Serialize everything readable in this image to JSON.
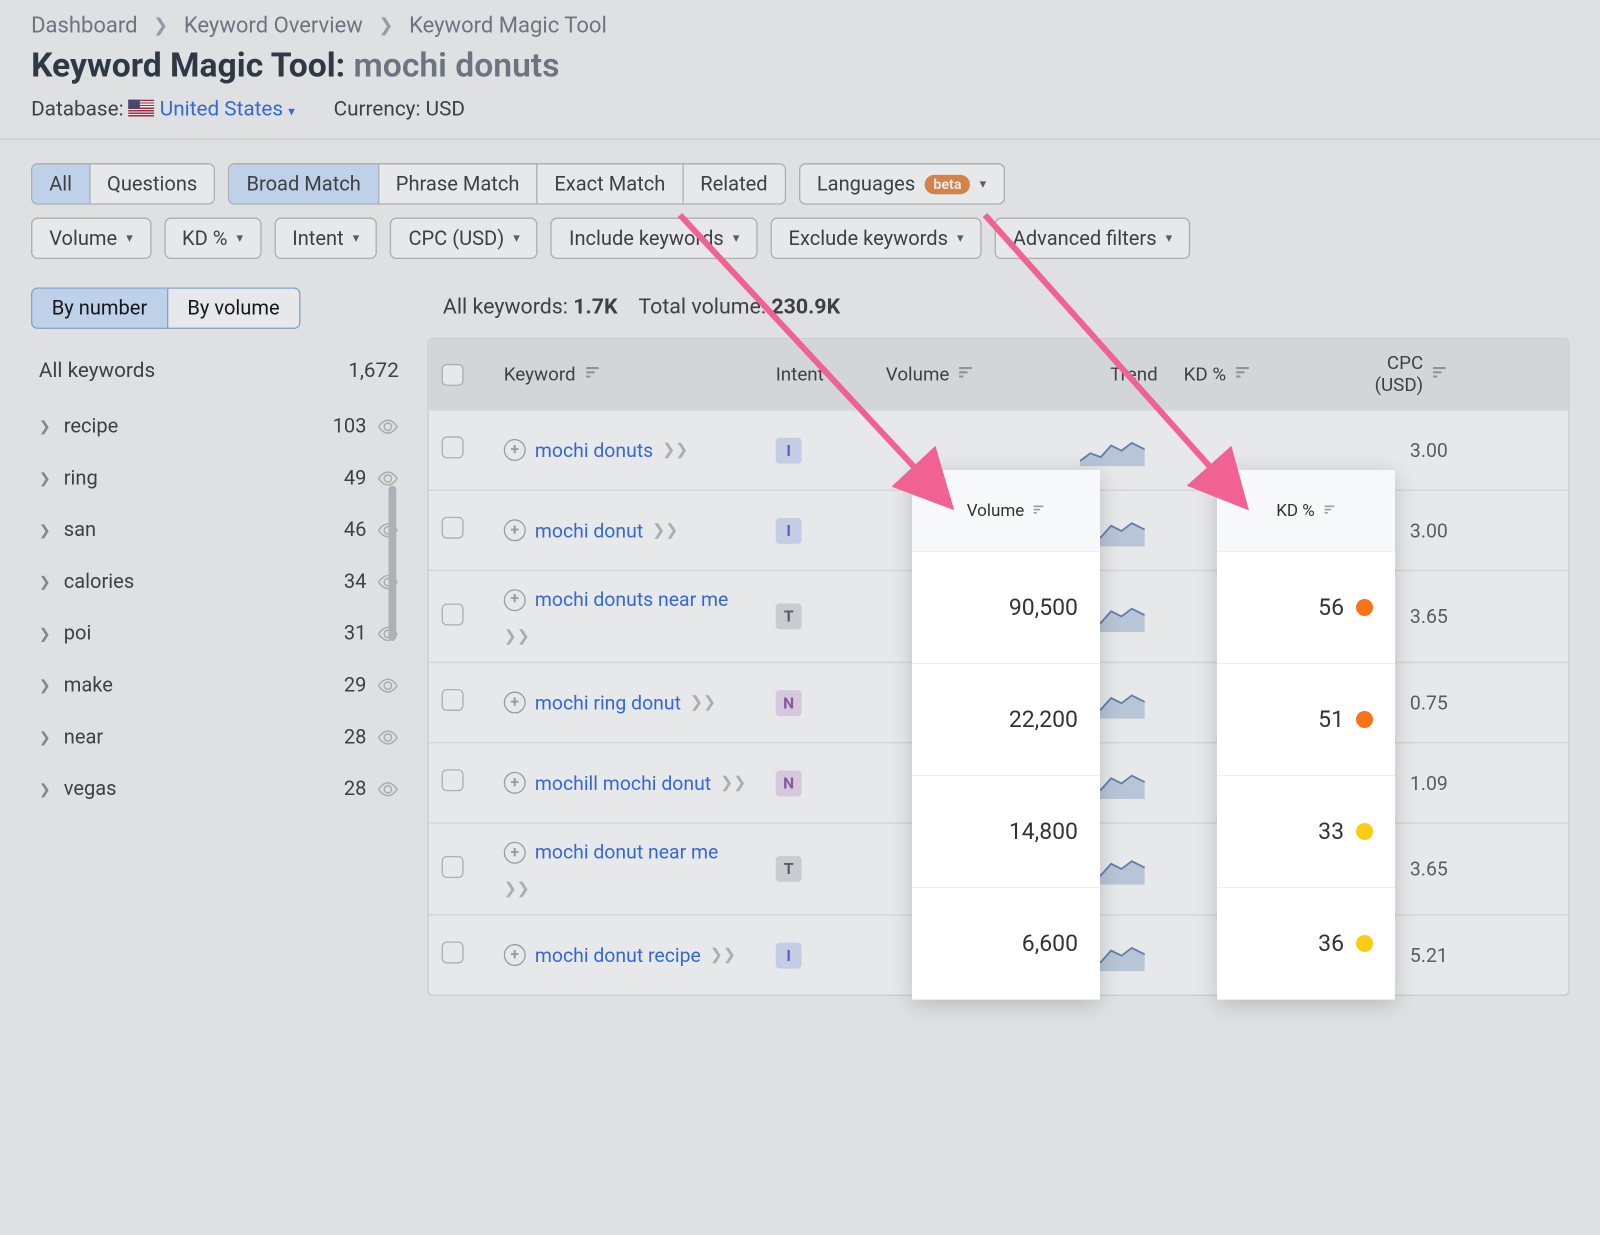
{
  "breadcrumb": [
    "Dashboard",
    "Keyword Overview",
    "Keyword Magic Tool"
  ],
  "header": {
    "title": "Keyword Magic Tool:",
    "query": "mochi donuts"
  },
  "meta": {
    "db_label": "Database:",
    "country": "United States",
    "currency_label": "Currency:",
    "currency": "USD"
  },
  "tabs_type": [
    {
      "label": "All",
      "active": true
    },
    {
      "label": "Questions",
      "active": false
    }
  ],
  "tabs_match": [
    {
      "label": "Broad Match",
      "active": true
    },
    {
      "label": "Phrase Match",
      "active": false
    },
    {
      "label": "Exact Match",
      "active": false
    },
    {
      "label": "Related",
      "active": false
    }
  ],
  "languages": {
    "label": "Languages",
    "beta": "beta"
  },
  "filters": [
    "Volume",
    "KD %",
    "Intent",
    "CPC (USD)",
    "Include keywords",
    "Exclude keywords",
    "Advanced filters"
  ],
  "side_tabs": [
    {
      "label": "By number",
      "active": true
    },
    {
      "label": "By volume",
      "active": false
    }
  ],
  "side_all": {
    "label": "All keywords",
    "count": "1,672"
  },
  "groups": [
    {
      "label": "recipe",
      "count": "103"
    },
    {
      "label": "ring",
      "count": "49"
    },
    {
      "label": "san",
      "count": "46"
    },
    {
      "label": "calories",
      "count": "34"
    },
    {
      "label": "poi",
      "count": "31"
    },
    {
      "label": "make",
      "count": "29"
    },
    {
      "label": "near",
      "count": "28"
    },
    {
      "label": "vegas",
      "count": "28"
    }
  ],
  "stats": {
    "all_label": "All keywords:",
    "all_value": "1.7K",
    "vol_label": "Total volume:",
    "vol_value": "230.9K"
  },
  "columns": {
    "kw": "Keyword",
    "intent": "Intent",
    "volume": "Volume",
    "trend": "Trend",
    "kd": "KD %",
    "cpc": "CPC (USD)"
  },
  "highlight": {
    "volume": [
      "90,500",
      "22,200",
      "14,800",
      "6,600"
    ],
    "kd": [
      {
        "v": "56",
        "c": "#f97316"
      },
      {
        "v": "51",
        "c": "#f97316"
      },
      {
        "v": "33",
        "c": "#facc15"
      },
      {
        "v": "36",
        "c": "#facc15"
      }
    ]
  },
  "rows": [
    {
      "kw": "mochi donuts",
      "intent": "I",
      "cpc": "3.00"
    },
    {
      "kw": "mochi donut",
      "intent": "I",
      "cpc": "3.00"
    },
    {
      "kw": "mochi donuts near me",
      "intent": "T",
      "cpc": "3.65"
    },
    {
      "kw": "mochi ring donut",
      "intent": "N",
      "cpc": "0.75"
    },
    {
      "kw": "mochill mochi donut",
      "intent": "N",
      "cpc": "1.09"
    },
    {
      "kw": "mochi donut near me",
      "intent": "T",
      "cpc": "3.65"
    },
    {
      "kw": "mochi donut recipe",
      "intent": "I",
      "cpc": "5.21"
    }
  ]
}
